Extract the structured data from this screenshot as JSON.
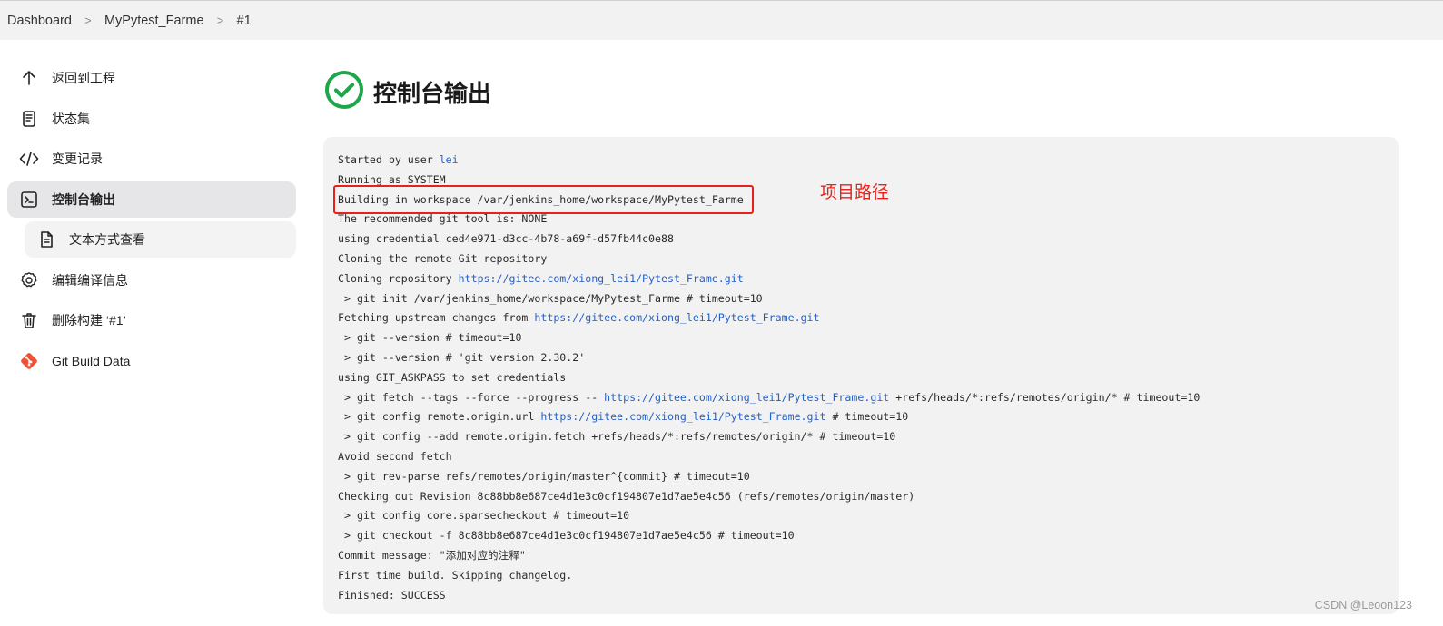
{
  "breadcrumb": {
    "items": [
      "Dashboard",
      "MyPytest_Farme",
      "#1"
    ],
    "separator": ">"
  },
  "sidebar": {
    "items": [
      {
        "label": "返回到工程",
        "icon": "arrow-up-icon"
      },
      {
        "label": "状态集",
        "icon": "document-icon"
      },
      {
        "label": "变更记录",
        "icon": "code-icon"
      },
      {
        "label": "控制台输出",
        "icon": "terminal-icon",
        "active": true
      },
      {
        "label": "文本方式查看",
        "icon": "file-text-icon",
        "sub": true
      },
      {
        "label": "编辑编译信息",
        "icon": "gear-icon"
      },
      {
        "label": "删除构建 ‘#1’",
        "icon": "trash-icon"
      },
      {
        "label": "Git Build Data",
        "icon": "git-icon"
      }
    ]
  },
  "main": {
    "title": "控制台输出",
    "status_icon": "success-check-icon",
    "status_color": "#1ea64b"
  },
  "console": {
    "link_color": "#2560c4",
    "lines": [
      [
        {
          "t": "Started by user "
        },
        {
          "t": "lei",
          "link": true
        }
      ],
      [
        {
          "t": "Running as SYSTEM"
        }
      ],
      [
        {
          "t": "Building in workspace /var/jenkins_home/workspace/MyPytest_Farme"
        }
      ],
      [
        {
          "t": "The recommended git tool is: NONE"
        }
      ],
      [
        {
          "t": "using credential ced4e971-d3cc-4b78-a69f-d57fb44c0e88"
        }
      ],
      [
        {
          "t": "Cloning the remote Git repository"
        }
      ],
      [
        {
          "t": "Cloning repository "
        },
        {
          "t": "https://gitee.com/xiong_lei1/Pytest_Frame.git",
          "link": true
        }
      ],
      [
        {
          "t": " > git init /var/jenkins_home/workspace/MyPytest_Farme # timeout=10"
        }
      ],
      [
        {
          "t": "Fetching upstream changes from "
        },
        {
          "t": "https://gitee.com/xiong_lei1/Pytest_Frame.git",
          "link": true
        }
      ],
      [
        {
          "t": " > git --version # timeout=10"
        }
      ],
      [
        {
          "t": " > git --version # 'git version 2.30.2'"
        }
      ],
      [
        {
          "t": "using GIT_ASKPASS to set credentials"
        }
      ],
      [
        {
          "t": " > git fetch --tags --force --progress -- "
        },
        {
          "t": "https://gitee.com/xiong_lei1/Pytest_Frame.git",
          "link": true
        },
        {
          "t": " +refs/heads/*:refs/remotes/origin/* # timeout=10"
        }
      ],
      [
        {
          "t": " > git config remote.origin.url "
        },
        {
          "t": "https://gitee.com/xiong_lei1/Pytest_Frame.git",
          "link": true
        },
        {
          "t": " # timeout=10"
        }
      ],
      [
        {
          "t": " > git config --add remote.origin.fetch +refs/heads/*:refs/remotes/origin/* # timeout=10"
        }
      ],
      [
        {
          "t": "Avoid second fetch"
        }
      ],
      [
        {
          "t": " > git rev-parse refs/remotes/origin/master^{commit} # timeout=10"
        }
      ],
      [
        {
          "t": "Checking out Revision 8c88bb8e687ce4d1e3c0cf194807e1d7ae5e4c56 (refs/remotes/origin/master)"
        }
      ],
      [
        {
          "t": " > git config core.sparsecheckout # timeout=10"
        }
      ],
      [
        {
          "t": " > git checkout -f 8c88bb8e687ce4d1e3c0cf194807e1d7ae5e4c56 # timeout=10"
        }
      ],
      [
        {
          "t": "Commit message: \"添加对应的注释\""
        }
      ],
      [
        {
          "t": "First time build. Skipping changelog."
        }
      ],
      [
        {
          "t": "Finished: SUCCESS"
        }
      ]
    ]
  },
  "annotation": {
    "label": "项目路径",
    "color": "#e8211b"
  },
  "watermark": "CSDN @Leoon123"
}
